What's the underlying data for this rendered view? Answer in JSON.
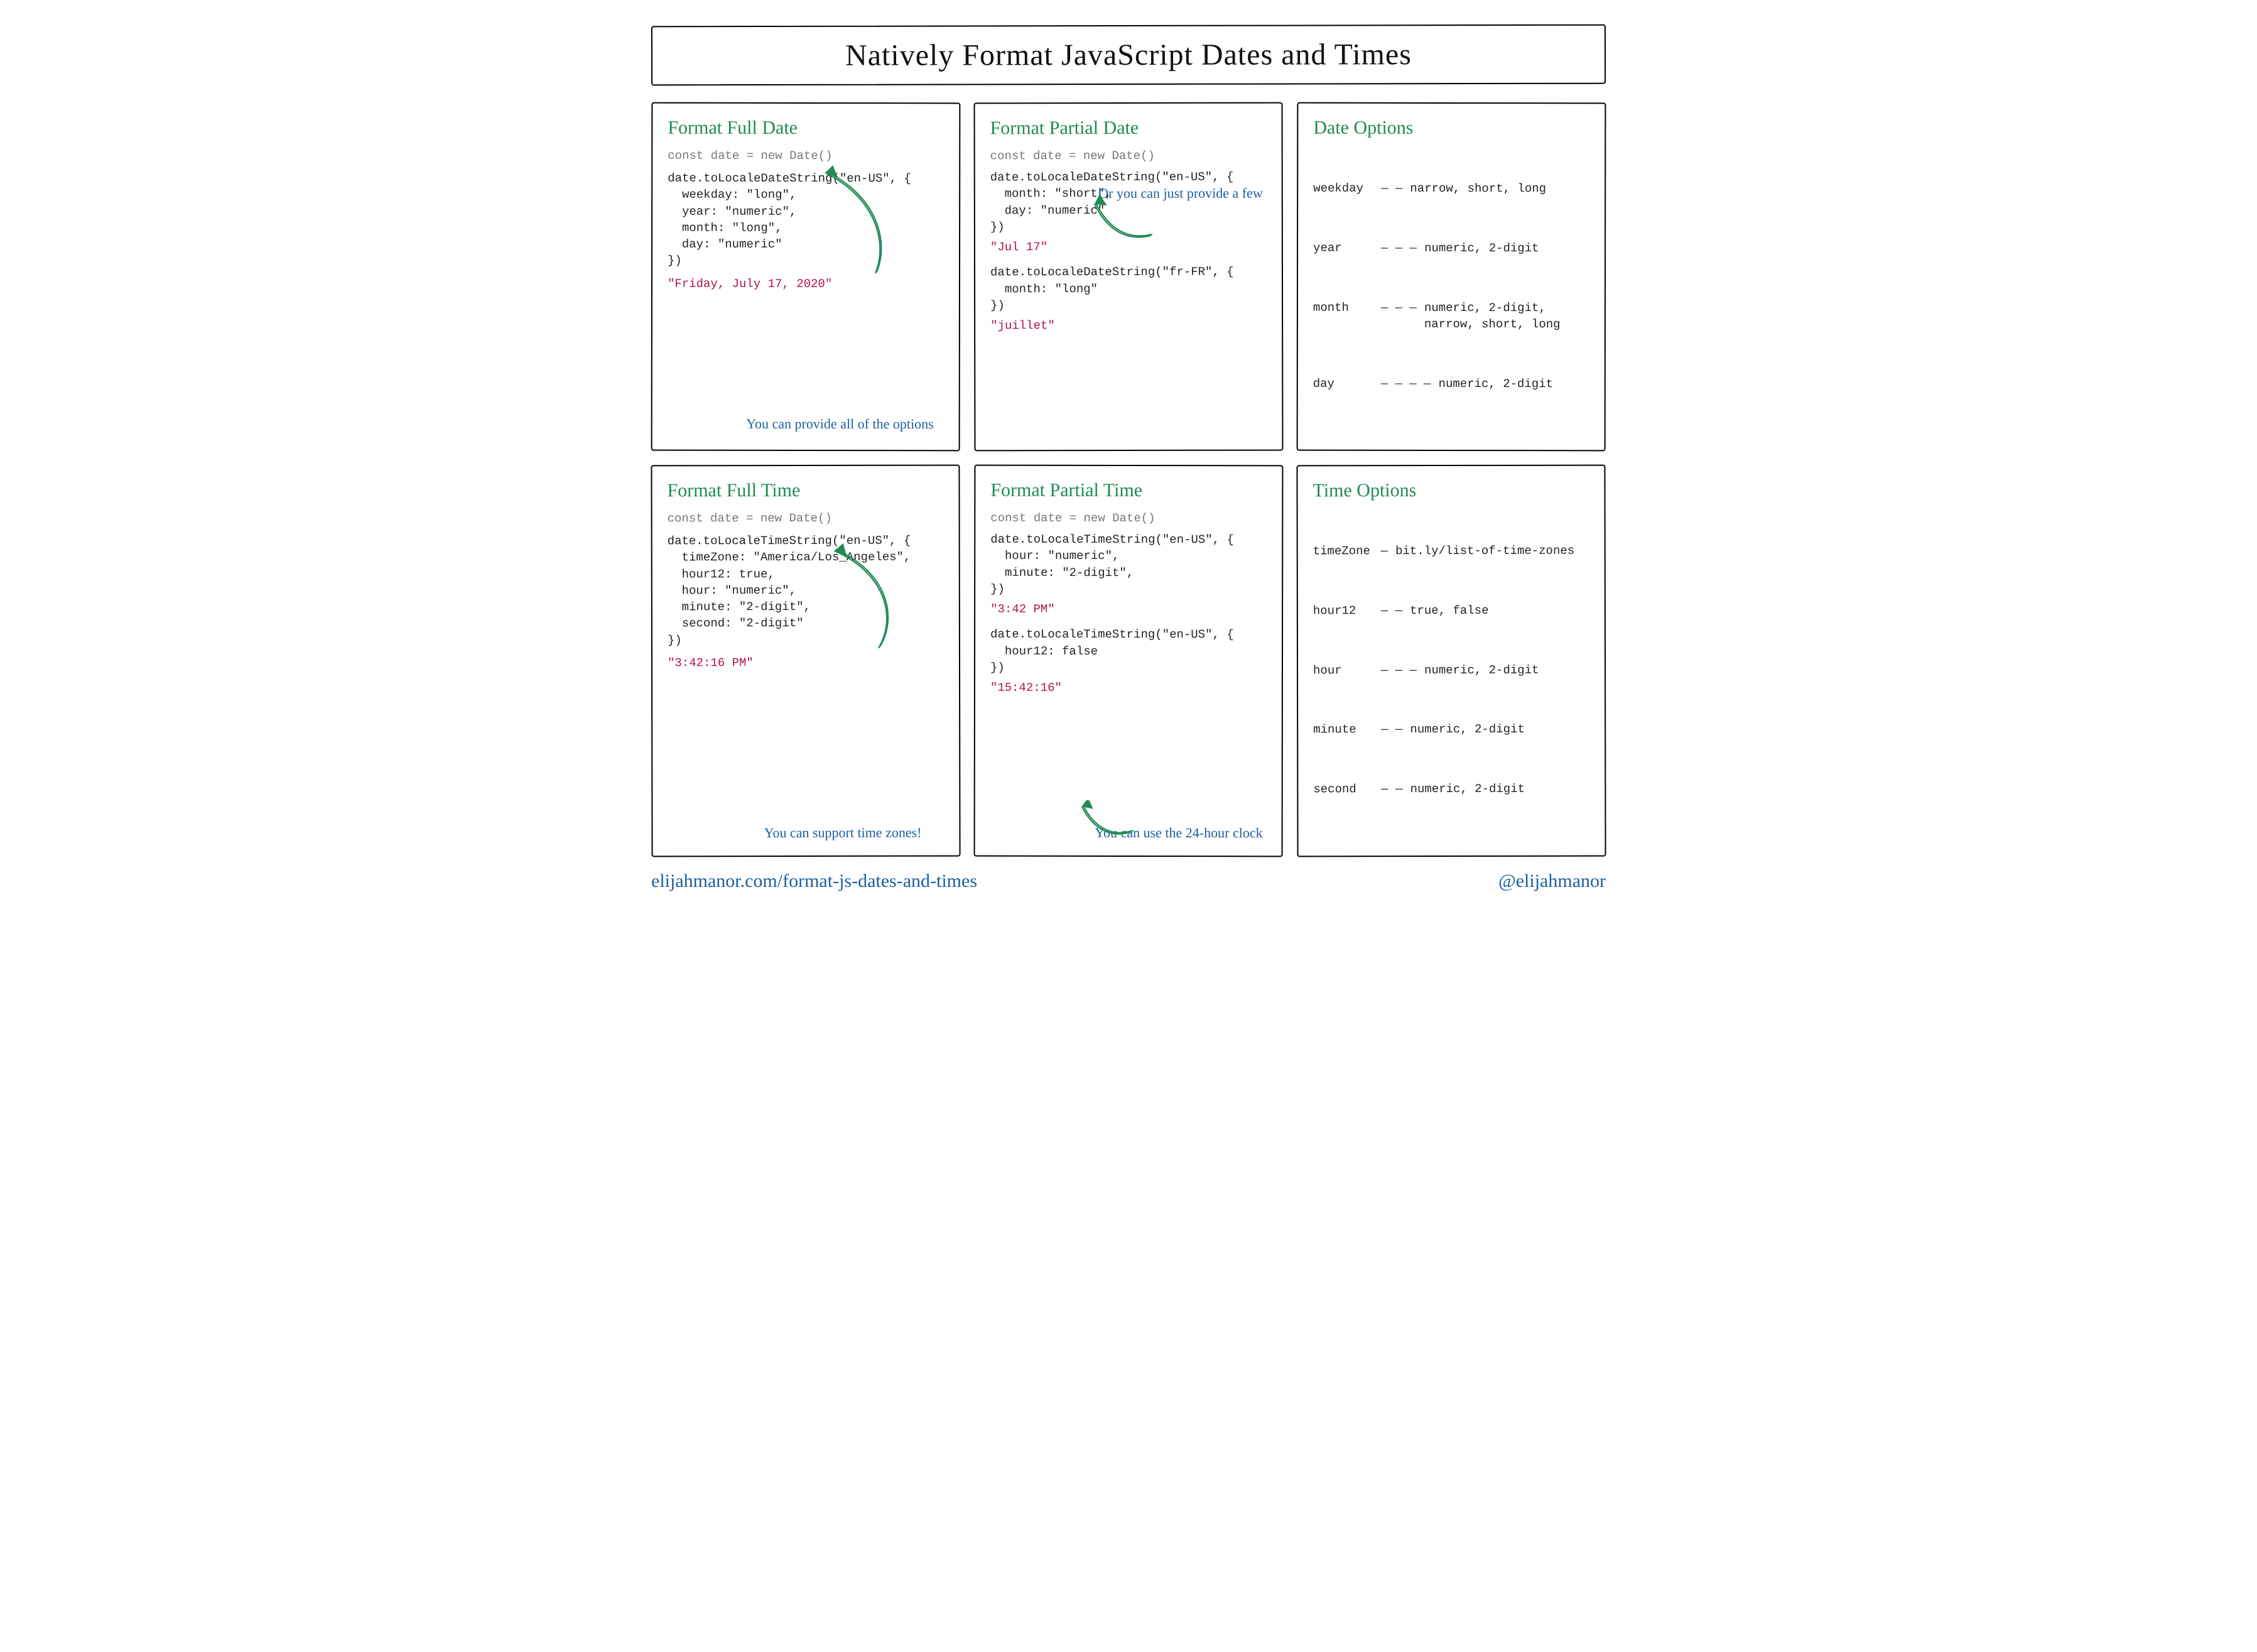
{
  "title": "Natively Format JavaScript Dates and Times",
  "cards": {
    "fullDate": {
      "heading": "Format Full Date",
      "codeDecl": "const date = new Date()",
      "code": "date.toLocaleDateString(\"en-US\", {\n  weekday: \"long\",\n  year: \"numeric\",\n  month: \"long\",\n  day: \"numeric\"\n})",
      "output": "\"Friday, July 17, 2020\"",
      "annotation": "You can provide all\nof the options"
    },
    "partialDate": {
      "heading": "Format Partial Date",
      "codeDecl": "const date = new Date()",
      "code1": "date.toLocaleDateString(\"en-US\", {\n  month: \"short\",\n  day: \"numeric\"\n})",
      "output1": "\"Jul 17\"",
      "code2": "date.toLocaleDateString(\"fr-FR\", {\n  month: \"long\"\n})",
      "output2": "\"juillet\"",
      "annotation": "Or you can just\nprovide a few"
    },
    "dateOptions": {
      "heading": "Date Options",
      "rows": [
        {
          "key": "weekday",
          "dash": "— —",
          "val": "narrow, short, long"
        },
        {
          "key": "year",
          "dash": "— — —",
          "val": "numeric, 2-digit"
        },
        {
          "key": "month",
          "dash": "— — —",
          "val": "numeric, 2-digit,\nnarrow, short, long"
        },
        {
          "key": "day",
          "dash": "— — — —",
          "val": "numeric, 2-digit"
        }
      ]
    },
    "fullTime": {
      "heading": "Format Full Time",
      "codeDecl": "const date = new Date()",
      "code": "date.toLocaleTimeString(\"en-US\", {\n  timeZone: \"America/Los_Angeles\",\n  hour12: true,\n  hour: \"numeric\",\n  minute: \"2-digit\",\n  second: \"2-digit\"\n})",
      "output": "\"3:42:16 PM\"",
      "annotation": "You can support\ntime zones!"
    },
    "partialTime": {
      "heading": "Format Partial Time",
      "codeDecl": "const date = new Date()",
      "code1": "date.toLocaleTimeString(\"en-US\", {\n  hour: \"numeric\",\n  minute: \"2-digit\",\n})",
      "output1": "\"3:42 PM\"",
      "code2": "date.toLocaleTimeString(\"en-US\", {\n  hour12: false\n})",
      "output2": "\"15:42:16\"",
      "annotation": "You can use the\n24-hour clock"
    },
    "timeOptions": {
      "heading": "Time Options",
      "rows": [
        {
          "key": "timeZone",
          "dash": "—",
          "val": "bit.ly/list-of-time-zones"
        },
        {
          "key": "hour12",
          "dash": "— —",
          "val": "true, false"
        },
        {
          "key": "hour",
          "dash": "— — —",
          "val": "numeric, 2-digit"
        },
        {
          "key": "minute",
          "dash": "— —",
          "val": "numeric, 2-digit"
        },
        {
          "key": "second",
          "dash": "— —",
          "val": "numeric, 2-digit"
        }
      ]
    }
  },
  "footer": {
    "url": "elijahmanor.com/format-js-dates-and-times",
    "handle": "@elijahmanor"
  }
}
